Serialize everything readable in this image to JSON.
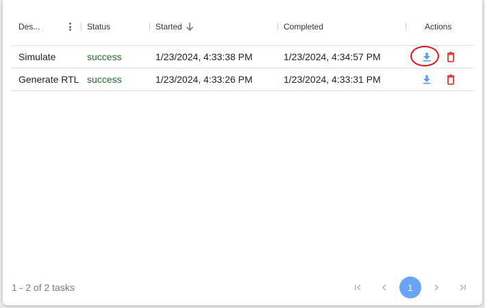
{
  "table": {
    "columns": {
      "description": "Des...",
      "status": "Status",
      "started": "Started",
      "completed": "Completed",
      "actions": "Actions"
    },
    "rows": [
      {
        "description": "Simulate",
        "status": "success",
        "started": "1/23/2024, 4:33:38 PM",
        "completed": "1/23/2024, 4:34:57 PM"
      },
      {
        "description": "Generate RTL",
        "status": "success",
        "started": "1/23/2024, 4:33:26 PM",
        "completed": "1/23/2024, 4:33:31 PM"
      }
    ],
    "sort": {
      "column": "started",
      "direction": "descending"
    }
  },
  "icons": {
    "column_menu": "more-vert-icon",
    "sort": "arrow-down-icon",
    "download": "download-icon",
    "delete": "trash-icon",
    "first_page": "first-page-icon",
    "prev_page": "chevron-left-icon",
    "next_page": "chevron-right-icon",
    "last_page": "last-page-icon"
  },
  "colors": {
    "status_success": "#1e6b2a",
    "download": "#5b9cf2",
    "delete": "#e53935",
    "pager_current": "#6aa5f5",
    "highlight": "#e0101a"
  },
  "footer": {
    "summary": "1 - 2 of 2 tasks",
    "current_page": "1"
  }
}
